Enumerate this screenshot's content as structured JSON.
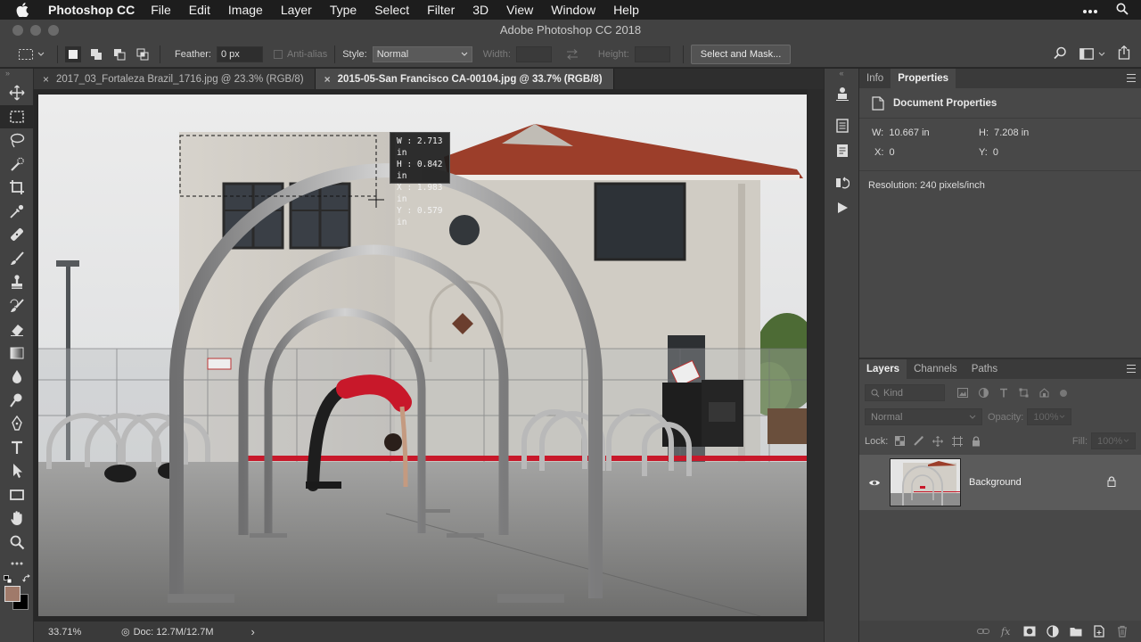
{
  "menubar": {
    "app_name": "Photoshop CC",
    "items": [
      "File",
      "Edit",
      "Image",
      "Layer",
      "Type",
      "Select",
      "Filter",
      "3D",
      "View",
      "Window",
      "Help"
    ]
  },
  "window": {
    "title": "Adobe Photoshop CC 2018"
  },
  "options_bar": {
    "feather_label": "Feather:",
    "feather_value": "0 px",
    "antialias_label": "Anti-alias",
    "style_label": "Style:",
    "style_value": "Normal",
    "width_label": "Width:",
    "height_label": "Height:",
    "select_mask_label": "Select and Mask..."
  },
  "tabs": [
    {
      "label": "2017_03_Fortaleza Brazil_1716.jpg @ 23.3% (RGB/8)",
      "close": "×",
      "active": false
    },
    {
      "label": "2015-05-San Francisco CA-00104.jpg @ 33.7% (RGB/8)",
      "close": "×",
      "active": true
    }
  ],
  "selection_readout": {
    "w": "W :  2.713 in",
    "h": "H :  0.842 in",
    "x": "X :  1.983 in",
    "y": "Y :  0.579 in"
  },
  "status_bar": {
    "zoom": "33.71%",
    "doc": "Doc: 12.7M/12.7M",
    "arrow": "›"
  },
  "properties_panel": {
    "tabs": [
      "Info",
      "Properties"
    ],
    "active_tab": "Properties",
    "header": "Document Properties",
    "w_label": "W:",
    "w_value": "10.667 in",
    "h_label": "H:",
    "h_value": "7.208 in",
    "x_label": "X:",
    "x_value": "0",
    "y_label": "Y:",
    "y_value": "0",
    "resolution": "Resolution: 240 pixels/inch"
  },
  "layers_panel": {
    "tabs": [
      "Layers",
      "Channels",
      "Paths"
    ],
    "active_tab": "Layers",
    "kind_label": "Kind",
    "blend_mode": "Normal",
    "opacity_label": "Opacity:",
    "opacity_value": "100%",
    "lock_label": "Lock:",
    "fill_label": "Fill:",
    "fill_value": "100%",
    "layers": [
      {
        "name": "Background",
        "visible": true,
        "locked": true
      }
    ]
  },
  "colors": {
    "foreground": "#a07a6a",
    "background": "#000000",
    "accent_red": "#c8182a"
  }
}
